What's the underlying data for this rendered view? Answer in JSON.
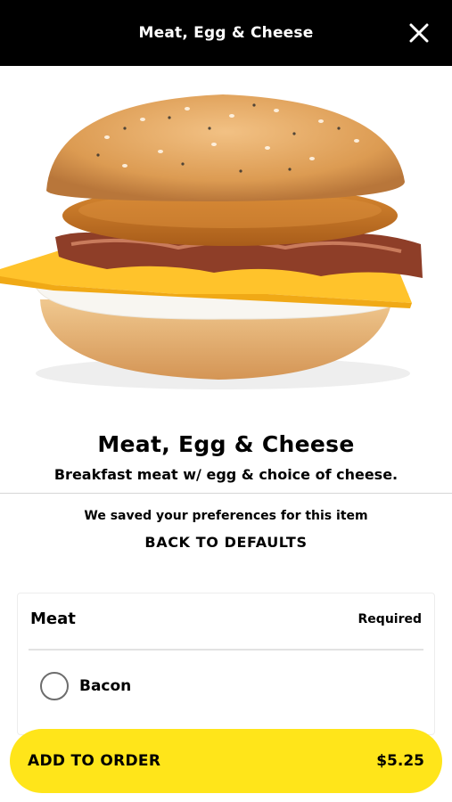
{
  "header": {
    "title": "Meat, Egg & Cheese",
    "close_icon": "close-icon"
  },
  "hero": {
    "image": "sandwich-photo",
    "colors": {
      "bun": "#e6a55a",
      "cheese": "#ffc324",
      "egg": "#f7f4ee",
      "bacon": "#8a3a26",
      "patty": "#c8741f"
    }
  },
  "item": {
    "title": "Meat, Egg & Cheese",
    "description": "Breakfast meat w/ egg & choice of cheese."
  },
  "preferences": {
    "saved_text": "We saved your preferences for this item",
    "back_to_defaults": "BACK TO DEFAULTS"
  },
  "meat_section": {
    "title": "Meat",
    "badge": "Required",
    "options": [
      {
        "label": "Bacon",
        "selected": false
      }
    ]
  },
  "add_to_order": {
    "label": "ADD TO ORDER",
    "price": "$5.25",
    "color": "#ffe51a"
  }
}
